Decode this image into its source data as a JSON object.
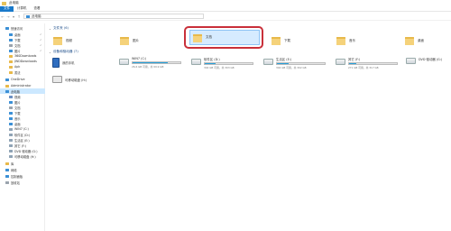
{
  "window": {
    "title": "此电脑"
  },
  "ribbon": {
    "tabs": [
      "文件",
      "计算机",
      "查看"
    ]
  },
  "address": {
    "path": "此电脑",
    "up_glyph": "↑",
    "dropdown_glyph": "▾",
    "back_glyph": "←",
    "forward_glyph": "→"
  },
  "sidebar": {
    "items": [
      {
        "label": "快速访问",
        "icon": "star-icon",
        "color": "#3a8fd6"
      },
      {
        "label": "桌面",
        "icon": "desktop-icon",
        "color": "#3a8fd6",
        "pin": "✓"
      },
      {
        "label": "下载",
        "icon": "download-icon",
        "color": "#3a8fd6",
        "pin": "✓"
      },
      {
        "label": "文档",
        "icon": "document-icon",
        "color": "#9aa3ad",
        "pin": "✓"
      },
      {
        "label": "图片",
        "icon": "picture-icon",
        "color": "#3a8fd6",
        "pin": "✓"
      },
      {
        "label": "360Downloads",
        "icon": "folder-icon",
        "color": "#e8b94a"
      },
      {
        "label": "JWDDownloads",
        "icon": "folder-icon",
        "color": "#e8b94a"
      },
      {
        "label": "Apk",
        "icon": "folder-icon",
        "color": "#e8b94a"
      },
      {
        "label": "書法",
        "icon": "folder-icon",
        "color": "#e8b94a"
      },
      {
        "label": "OneDrive",
        "icon": "cloud-icon",
        "color": "#3a8fd6"
      },
      {
        "label": "Administrator",
        "icon": "user-icon",
        "color": "#e8b94a"
      },
      {
        "label": "此电脑",
        "icon": "computer-icon",
        "color": "#3a8fd6"
      },
      {
        "label": "视频",
        "icon": "video-icon",
        "color": "#6b8fc2"
      },
      {
        "label": "图片",
        "icon": "picture-icon",
        "color": "#3a8fd6"
      },
      {
        "label": "文档",
        "icon": "document-icon",
        "color": "#9aa3ad"
      },
      {
        "label": "下载",
        "icon": "download-icon",
        "color": "#3a8fd6"
      },
      {
        "label": "音乐",
        "icon": "music-icon",
        "color": "#3a8fd6"
      },
      {
        "label": "桌面",
        "icon": "desktop-icon",
        "color": "#3a8fd6"
      },
      {
        "label": "WIN7 (C:)",
        "icon": "drive-icon",
        "color": "#8fa3b5"
      },
      {
        "label": "软件区 (D:)",
        "icon": "drive-icon",
        "color": "#8fa3b5"
      },
      {
        "label": "生活区 (E:)",
        "icon": "drive-icon",
        "color": "#8fa3b5"
      },
      {
        "label": "其它 (F:)",
        "icon": "drive-icon",
        "color": "#8fa3b5"
      },
      {
        "label": "DVD 驱动器 (G:)",
        "icon": "dvd-icon",
        "color": "#8fa3b5"
      },
      {
        "label": "可移动磁盘 (H:)",
        "icon": "usb-drive-icon",
        "color": "#8fa3b5"
      },
      {
        "label": "库",
        "icon": "library-icon",
        "color": "#e8b94a"
      },
      {
        "label": "网络",
        "icon": "network-icon",
        "color": "#3a8fd6"
      },
      {
        "label": "控制面板",
        "icon": "control-panel-icon",
        "color": "#3a8fd6"
      },
      {
        "label": "回收站",
        "icon": "recycle-bin-icon",
        "color": "#9aa3ad"
      }
    ]
  },
  "main": {
    "folders_header": "文件夹 (6)",
    "folders": [
      {
        "label": "视频"
      },
      {
        "label": "图片"
      },
      {
        "label": "文档"
      },
      {
        "label": "下载"
      },
      {
        "label": "音乐"
      },
      {
        "label": "桌面"
      }
    ],
    "devices_header": "设备和驱动器 (7)",
    "devices": [
      {
        "label": "我的手机"
      },
      {
        "label": "可移动磁盘 (H:)"
      }
    ],
    "drives": [
      {
        "name": "WIN7 (C:)",
        "space": "26.6 GB 可用，共 99.9 GB",
        "fill": 0.73
      },
      {
        "name": "软件区 (D:)",
        "space": "304 GB 可用，共 303 GB",
        "fill": 0.22
      },
      {
        "name": "生活区 (E:)",
        "space": "304 GB 可用，共 302 GB",
        "fill": 0.24
      },
      {
        "name": "其它 (F:)",
        "space": "271 GB 可用，共 317 GB",
        "fill": 0.15
      },
      {
        "name": "DVD 驱动器 (G:)",
        "space": "",
        "fill": 0
      }
    ]
  },
  "colors": {
    "accent": "#1979ca",
    "selection": "#cce8ff",
    "highlight": "#c9303a"
  }
}
